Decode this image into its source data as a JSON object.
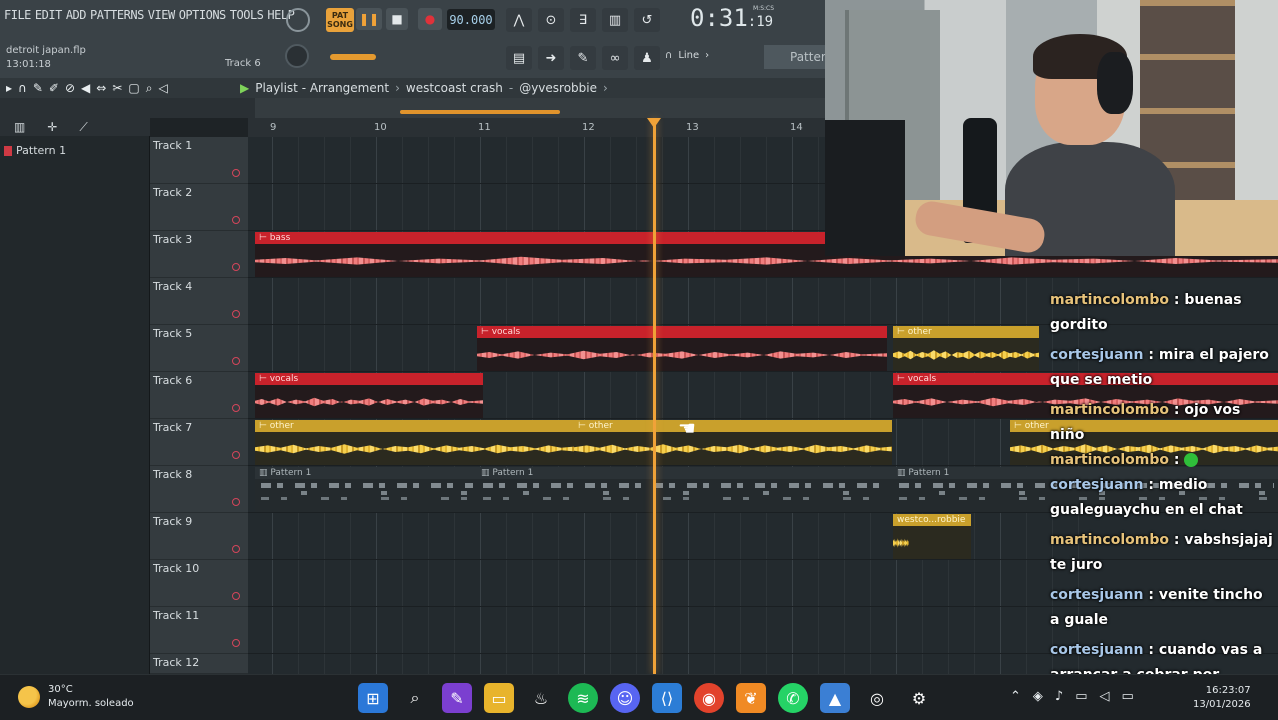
{
  "menu": [
    "FILE",
    "EDIT",
    "ADD",
    "PATTERNS",
    "VIEW",
    "OPTIONS",
    "TOOLS",
    "HELP"
  ],
  "file": {
    "name": "detroit japan.flp",
    "clock": "13:01:18"
  },
  "track_hint": "Track 6",
  "transport": {
    "mode": "SONG",
    "mode_top": "PAT",
    "tempo": "90.000",
    "time_main": "0:31",
    "time_sub": ":19",
    "time_unit": "M:S:CS"
  },
  "snap": {
    "label": "Line"
  },
  "pattern_button": "Patter",
  "playlist_title": {
    "prefix": "Playlist - Arrangement",
    "project": "westcoast crash",
    "artist": "@yvesrobbie"
  },
  "picker": {
    "item": "Pattern 1"
  },
  "ruler": [
    "9",
    "10",
    "11",
    "12",
    "13",
    "14"
  ],
  "tracks": [
    "Track 1",
    "Track 2",
    "Track 3",
    "Track 4",
    "Track 5",
    "Track 6",
    "Track 7",
    "Track 8",
    "Track 9",
    "Track 10",
    "Track 11",
    "Track 12"
  ],
  "clips": {
    "bass": "bass",
    "vocals": "vocals",
    "other": "other",
    "pattern": "Pattern 1",
    "westco": "westco...robbie"
  },
  "chat": [
    {
      "user": "martincolombo",
      "text": "buenas gordito"
    },
    {
      "user": "cortesjuann",
      "text": "mira el pajero que se metio"
    },
    {
      "user": "martincolombo",
      "text": "ojo vos niño"
    },
    {
      "user": "martincolombo",
      "text": ""
    },
    {
      "user": "cortesjuann",
      "text": "medio gualeguaychu en el chat"
    },
    {
      "user": "martincolombo",
      "text": "vabshsjajaj te juro"
    },
    {
      "user": "cortesjuann",
      "text": "venite tincho a guale"
    },
    {
      "user": "cortesjuann",
      "text": "cuando vas a arrancar a cobrar por stream?"
    }
  ],
  "weather": {
    "temp": "30°C",
    "desc": "Mayorm. soleado"
  },
  "clock": {
    "time": "16:23:07",
    "date": "13/01/2026"
  },
  "colors": {
    "accent": "#f0a238",
    "clip_red": "#c8222b",
    "clip_yellow": "#c9a02c"
  }
}
